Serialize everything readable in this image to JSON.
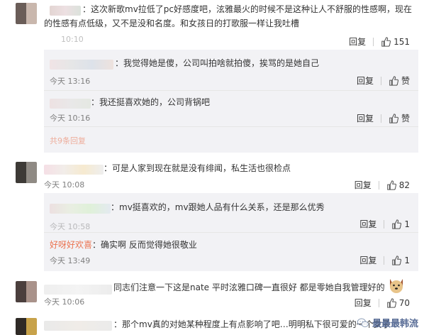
{
  "comments": [
    {
      "text_line1": "：这次新歌mv拉低了pc好感度吧，泫雅最火的时候不是这种让人不舒服的性感啊，现在",
      "text_line2": "的性感有点低级，又不是没和名度。和女孩日的打歌服一样让我吐槽",
      "time": "10:10",
      "reply_label": "回复",
      "like_count": "151"
    },
    {
      "text": "：那个mv真的对她某种程度上有点影响了吧…明明私下很可爱的一个女子"
    }
  ],
  "replies_group1": [
    {
      "text": "：我觉得她是傻，公司叫拍啥就拍傻，挨骂的是她自己",
      "time": "今天 13:16",
      "reply_label": "回复",
      "like_label": "赞"
    },
    {
      "text": "：我还挺喜欢她的，公司背锅吧",
      "time": "今天 10:16",
      "reply_label": "回复",
      "like_label": "赞"
    }
  ],
  "more_replies_label": "共9条回复",
  "comment2": {
    "text": "：可是人家到现在就是没有绯闻，私生活也很检点",
    "time": "今天 10:08",
    "reply_label": "回复",
    "like_count": "82"
  },
  "replies_group2": [
    {
      "text": "：mv挺喜欢的，mv跟她人品有什么关系，还是那么优秀",
      "time": "今天 10:58",
      "reply_label": "回复",
      "like_count": "1"
    },
    {
      "name": "好呀好欢喜",
      "text": "：确实啊 反而觉得她很敬业",
      "time": "今天 13:49",
      "reply_label": "回复",
      "like_count": "1"
    }
  ],
  "comment3": {
    "text": "同志们注意一下这是nate   平时泫雅口碑一直很好  都是零她自我管理好的",
    "time": "今天 10:06",
    "reply_label": "回复",
    "like_count": "70"
  },
  "watermark": {
    "text": "最最最韩流",
    "icon": "wechat-icon"
  },
  "colors": {
    "accent": "#eb7350",
    "time": "#808080",
    "reply_bg": "#f2f2f5"
  }
}
